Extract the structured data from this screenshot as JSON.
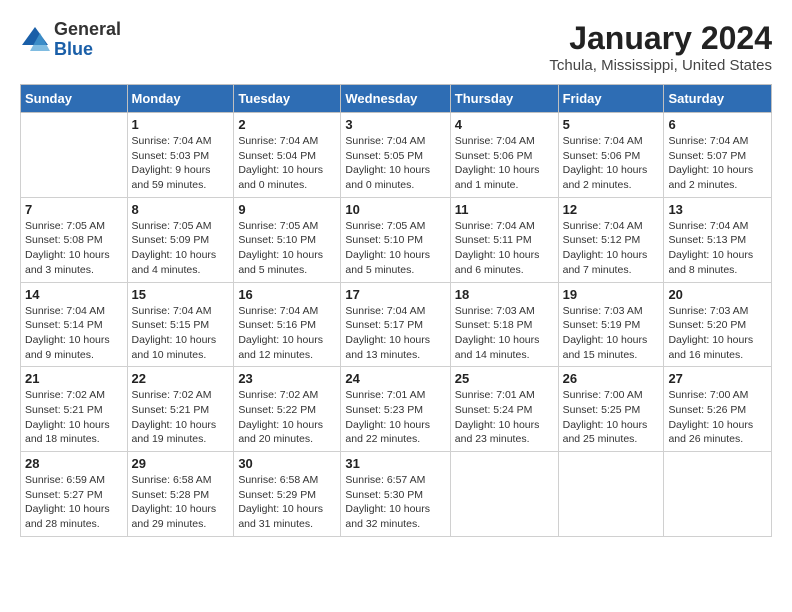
{
  "header": {
    "logo_general": "General",
    "logo_blue": "Blue",
    "title": "January 2024",
    "subtitle": "Tchula, Mississippi, United States"
  },
  "days_of_week": [
    "Sunday",
    "Monday",
    "Tuesday",
    "Wednesday",
    "Thursday",
    "Friday",
    "Saturday"
  ],
  "weeks": [
    [
      {
        "day": "",
        "info": ""
      },
      {
        "day": "1",
        "info": "Sunrise: 7:04 AM\nSunset: 5:03 PM\nDaylight: 9 hours\nand 59 minutes."
      },
      {
        "day": "2",
        "info": "Sunrise: 7:04 AM\nSunset: 5:04 PM\nDaylight: 10 hours\nand 0 minutes."
      },
      {
        "day": "3",
        "info": "Sunrise: 7:04 AM\nSunset: 5:05 PM\nDaylight: 10 hours\nand 0 minutes."
      },
      {
        "day": "4",
        "info": "Sunrise: 7:04 AM\nSunset: 5:06 PM\nDaylight: 10 hours\nand 1 minute."
      },
      {
        "day": "5",
        "info": "Sunrise: 7:04 AM\nSunset: 5:06 PM\nDaylight: 10 hours\nand 2 minutes."
      },
      {
        "day": "6",
        "info": "Sunrise: 7:04 AM\nSunset: 5:07 PM\nDaylight: 10 hours\nand 2 minutes."
      }
    ],
    [
      {
        "day": "7",
        "info": "Sunrise: 7:05 AM\nSunset: 5:08 PM\nDaylight: 10 hours\nand 3 minutes."
      },
      {
        "day": "8",
        "info": "Sunrise: 7:05 AM\nSunset: 5:09 PM\nDaylight: 10 hours\nand 4 minutes."
      },
      {
        "day": "9",
        "info": "Sunrise: 7:05 AM\nSunset: 5:10 PM\nDaylight: 10 hours\nand 5 minutes."
      },
      {
        "day": "10",
        "info": "Sunrise: 7:05 AM\nSunset: 5:10 PM\nDaylight: 10 hours\nand 5 minutes."
      },
      {
        "day": "11",
        "info": "Sunrise: 7:04 AM\nSunset: 5:11 PM\nDaylight: 10 hours\nand 6 minutes."
      },
      {
        "day": "12",
        "info": "Sunrise: 7:04 AM\nSunset: 5:12 PM\nDaylight: 10 hours\nand 7 minutes."
      },
      {
        "day": "13",
        "info": "Sunrise: 7:04 AM\nSunset: 5:13 PM\nDaylight: 10 hours\nand 8 minutes."
      }
    ],
    [
      {
        "day": "14",
        "info": "Sunrise: 7:04 AM\nSunset: 5:14 PM\nDaylight: 10 hours\nand 9 minutes."
      },
      {
        "day": "15",
        "info": "Sunrise: 7:04 AM\nSunset: 5:15 PM\nDaylight: 10 hours\nand 10 minutes."
      },
      {
        "day": "16",
        "info": "Sunrise: 7:04 AM\nSunset: 5:16 PM\nDaylight: 10 hours\nand 12 minutes."
      },
      {
        "day": "17",
        "info": "Sunrise: 7:04 AM\nSunset: 5:17 PM\nDaylight: 10 hours\nand 13 minutes."
      },
      {
        "day": "18",
        "info": "Sunrise: 7:03 AM\nSunset: 5:18 PM\nDaylight: 10 hours\nand 14 minutes."
      },
      {
        "day": "19",
        "info": "Sunrise: 7:03 AM\nSunset: 5:19 PM\nDaylight: 10 hours\nand 15 minutes."
      },
      {
        "day": "20",
        "info": "Sunrise: 7:03 AM\nSunset: 5:20 PM\nDaylight: 10 hours\nand 16 minutes."
      }
    ],
    [
      {
        "day": "21",
        "info": "Sunrise: 7:02 AM\nSunset: 5:21 PM\nDaylight: 10 hours\nand 18 minutes."
      },
      {
        "day": "22",
        "info": "Sunrise: 7:02 AM\nSunset: 5:21 PM\nDaylight: 10 hours\nand 19 minutes."
      },
      {
        "day": "23",
        "info": "Sunrise: 7:02 AM\nSunset: 5:22 PM\nDaylight: 10 hours\nand 20 minutes."
      },
      {
        "day": "24",
        "info": "Sunrise: 7:01 AM\nSunset: 5:23 PM\nDaylight: 10 hours\nand 22 minutes."
      },
      {
        "day": "25",
        "info": "Sunrise: 7:01 AM\nSunset: 5:24 PM\nDaylight: 10 hours\nand 23 minutes."
      },
      {
        "day": "26",
        "info": "Sunrise: 7:00 AM\nSunset: 5:25 PM\nDaylight: 10 hours\nand 25 minutes."
      },
      {
        "day": "27",
        "info": "Sunrise: 7:00 AM\nSunset: 5:26 PM\nDaylight: 10 hours\nand 26 minutes."
      }
    ],
    [
      {
        "day": "28",
        "info": "Sunrise: 6:59 AM\nSunset: 5:27 PM\nDaylight: 10 hours\nand 28 minutes."
      },
      {
        "day": "29",
        "info": "Sunrise: 6:58 AM\nSunset: 5:28 PM\nDaylight: 10 hours\nand 29 minutes."
      },
      {
        "day": "30",
        "info": "Sunrise: 6:58 AM\nSunset: 5:29 PM\nDaylight: 10 hours\nand 31 minutes."
      },
      {
        "day": "31",
        "info": "Sunrise: 6:57 AM\nSunset: 5:30 PM\nDaylight: 10 hours\nand 32 minutes."
      },
      {
        "day": "",
        "info": ""
      },
      {
        "day": "",
        "info": ""
      },
      {
        "day": "",
        "info": ""
      }
    ]
  ]
}
